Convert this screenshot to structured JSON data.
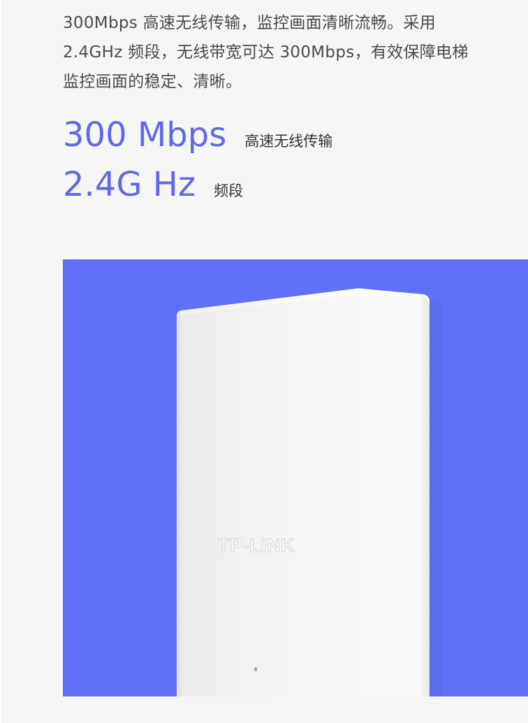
{
  "description": "300Mbps 高速无线传输，监控画面清晰流畅。采用 2.4GHz 频段，无线带宽可达 300Mbps，有效保障电梯监控画面的稳定、清晰。",
  "specs": [
    {
      "value": "300 Mbps",
      "label": "高速无线传输"
    },
    {
      "value": "2.4G Hz",
      "label": "频段"
    }
  ],
  "product": {
    "brand_logo_text": "TP-LINK",
    "background_color": "#6270f7",
    "device_color": "#f7f7f7"
  },
  "colors": {
    "accent": "#6168e8",
    "page_background": "#f6f6f6",
    "body_text": "#4a4a4a"
  }
}
